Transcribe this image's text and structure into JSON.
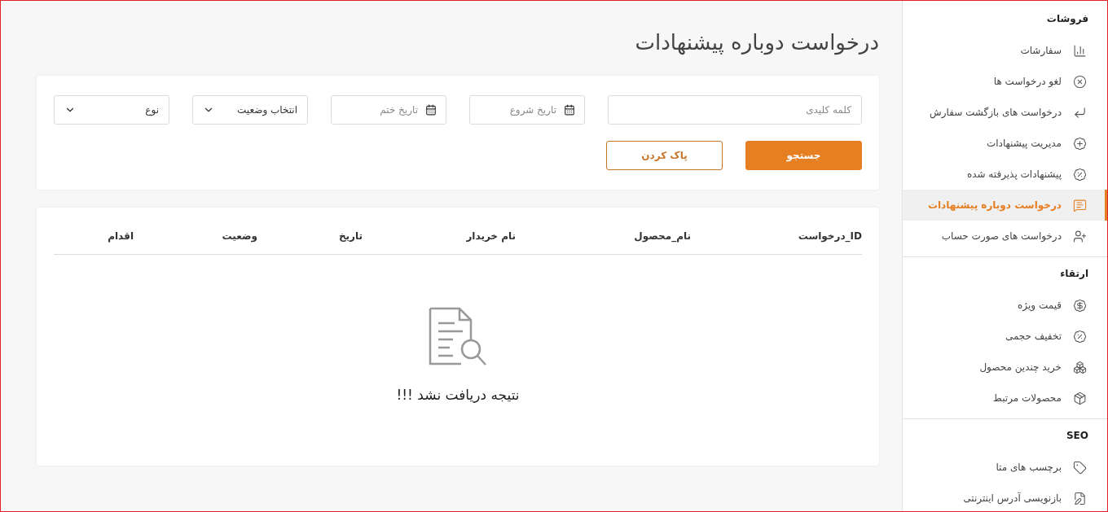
{
  "page": {
    "title": "درخواست دوباره پیشنهادات"
  },
  "filters": {
    "keyword": {
      "placeholder": "کلمه کلیدی"
    },
    "start_date": {
      "placeholder": "تاریخ شروع"
    },
    "end_date": {
      "placeholder": "تاریخ ختم"
    },
    "status_select": {
      "value": "انتخاب وضعیت"
    },
    "type_select": {
      "value": "نوع"
    }
  },
  "buttons": [
    {
      "label": "جستجو",
      "kind": "primary"
    },
    {
      "label": "پاک کردن",
      "kind": "outline"
    }
  ],
  "table": {
    "columns": [
      "ID_درخواست",
      "نام_محصول",
      "نام خریدار",
      "تاریخ",
      "وضعیت",
      "اقدام"
    ],
    "empty_message": "نتیجه دریافت نشد !!!"
  },
  "sidebar": {
    "sections": [
      {
        "title": "فروشات",
        "items": [
          {
            "label": "سفارشات",
            "selected": false
          },
          {
            "label": "لغو درخواست ها",
            "selected": false
          },
          {
            "label": "درخواست های بازگشت سفارش",
            "selected": false
          },
          {
            "label": "مدیریت پیشنهادات",
            "selected": false
          },
          {
            "label": "پیشنهادات پذیرفته شده",
            "selected": false
          },
          {
            "label": "درخواست دوباره پیشنهادات",
            "selected": true
          },
          {
            "label": "درخواست های صورت حساب",
            "selected": false
          }
        ]
      },
      {
        "title": "ارتقاء",
        "items": [
          {
            "label": "قیمت ویژه",
            "selected": false
          },
          {
            "label": "تخفیف حجمی",
            "selected": false
          },
          {
            "label": "خرید چندین محصول",
            "selected": false
          },
          {
            "label": "محصولات مرتبط",
            "selected": false
          }
        ]
      },
      {
        "title": "SEO",
        "items": [
          {
            "label": "برچسب های متا",
            "selected": false
          },
          {
            "label": "بازنویسی آدرس اینترنتی",
            "selected": false
          }
        ]
      }
    ]
  }
}
